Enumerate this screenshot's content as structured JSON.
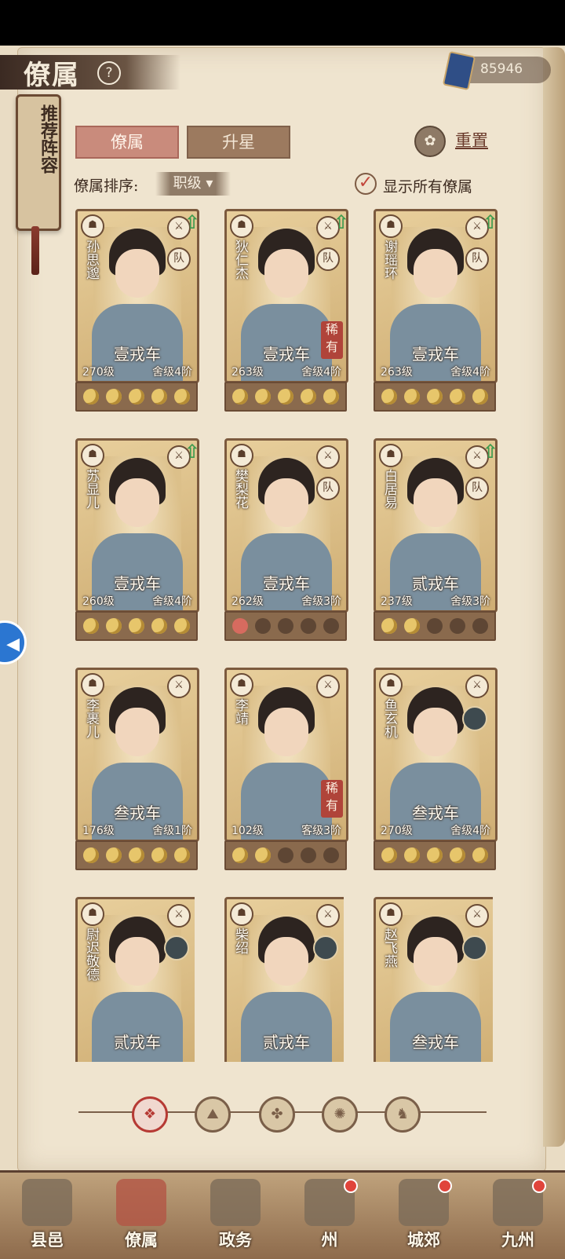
{
  "header": {
    "title": "僚属",
    "help_icon": "?",
    "currency_value": "85946"
  },
  "side_banner": {
    "label": "推荐阵容"
  },
  "tabs": [
    {
      "label": "僚属",
      "active": true
    },
    {
      "label": "升星",
      "active": false
    }
  ],
  "reset": {
    "label": "重置"
  },
  "sort": {
    "label": "僚属排序:",
    "selected": "职级"
  },
  "show_all": {
    "label": "显示所有僚属",
    "checked": true
  },
  "cards": [
    {
      "name": "孙思邈",
      "vehicle": "壹戎车",
      "level": "270级",
      "rank": "舍级4阶",
      "rarity": "",
      "team": "队",
      "upgrade": true,
      "stars_on": 5
    },
    {
      "name": "狄仁杰",
      "vehicle": "壹戎车",
      "level": "263级",
      "rank": "舍级4阶",
      "rarity": "稀有",
      "team": "队",
      "upgrade": true,
      "stars_on": 5
    },
    {
      "name": "谢瑶环",
      "vehicle": "壹戎车",
      "level": "263级",
      "rank": "舍级4阶",
      "rarity": "",
      "team": "队",
      "upgrade": true,
      "stars_on": 5
    },
    {
      "name": "苏显儿",
      "vehicle": "壹戎车",
      "level": "260级",
      "rank": "舍级4阶",
      "rarity": "",
      "team": "",
      "upgrade": true,
      "stars_on": 5
    },
    {
      "name": "樊梨花",
      "vehicle": "壹戎车",
      "level": "262级",
      "rank": "舍级3阶",
      "rarity": "",
      "team": "队",
      "upgrade": false,
      "stars_on": 1
    },
    {
      "name": "白居易",
      "vehicle": "贰戎车",
      "level": "237级",
      "rank": "舍级3阶",
      "rarity": "",
      "team": "队",
      "upgrade": true,
      "stars_on": 2
    },
    {
      "name": "李裹儿",
      "vehicle": "叁戎车",
      "level": "176级",
      "rank": "舍级1阶",
      "rarity": "",
      "team": "",
      "upgrade": false,
      "stars_on": 5
    },
    {
      "name": "李靖",
      "vehicle": "",
      "level": "102级",
      "rank": "客级3阶",
      "rarity": "稀有",
      "team": "",
      "upgrade": false,
      "stars_on": 2
    },
    {
      "name": "鱼玄机",
      "vehicle": "叁戎车",
      "level": "270级",
      "rank": "舍级4阶",
      "rarity": "",
      "team": "",
      "upgrade": false,
      "stars_on": 5
    },
    {
      "name": "尉迟敬德",
      "vehicle": "贰戎车",
      "level": "",
      "rank": "",
      "rarity": "",
      "team": "",
      "upgrade": false,
      "stars_on": 0
    },
    {
      "name": "柴绍",
      "vehicle": "贰戎车",
      "level": "",
      "rank": "",
      "rarity": "",
      "team": "",
      "upgrade": false,
      "stars_on": 0
    },
    {
      "name": "赵飞燕",
      "vehicle": "叁戎车",
      "level": "",
      "rank": "",
      "rarity": "",
      "team": "",
      "upgrade": false,
      "stars_on": 0
    }
  ],
  "filters": [
    "diamond-icon",
    "mountain-icon",
    "tree-icon",
    "fan-icon",
    "horse-icon"
  ],
  "nav": [
    {
      "label": "县邑",
      "dot": false
    },
    {
      "label": "僚属",
      "dot": false,
      "active": true
    },
    {
      "label": "政务",
      "dot": false
    },
    {
      "label": "州",
      "dot": true
    },
    {
      "label": "城郊",
      "dot": true
    },
    {
      "label": "九州",
      "dot": true
    }
  ]
}
